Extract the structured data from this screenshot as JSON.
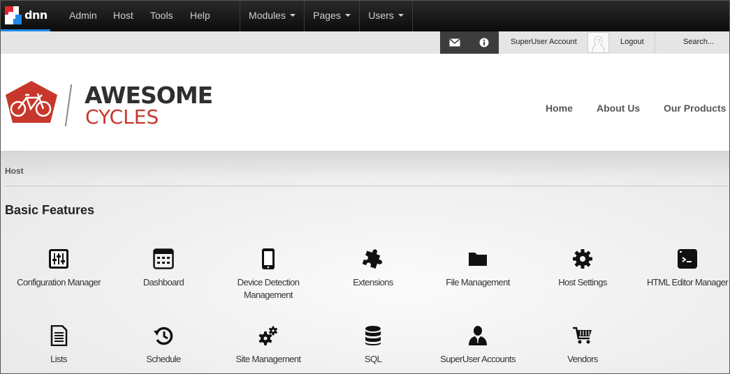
{
  "controlbar": {
    "logo_text": "dnn",
    "menu": [
      "Admin",
      "Host",
      "Tools",
      "Help"
    ],
    "dropdowns": [
      "Modules",
      "Pages",
      "Users"
    ]
  },
  "userbar": {
    "account": "SuperUser Account",
    "logout": "Logout",
    "search": "Search..."
  },
  "brand": {
    "line1": "AWESOME",
    "line2": "CYCLES"
  },
  "nav": [
    "Home",
    "About Us",
    "Our Products"
  ],
  "breadcrumb": "Host",
  "section_title": "Basic Features",
  "features": [
    {
      "label": "Configuration Manager",
      "icon": "sliders-icon"
    },
    {
      "label": "Dashboard",
      "icon": "dashboard-icon"
    },
    {
      "label": "Device Detection Management",
      "icon": "mobile-device-icon"
    },
    {
      "label": "Extensions",
      "icon": "puzzle-icon"
    },
    {
      "label": "File Management",
      "icon": "folder-icon"
    },
    {
      "label": "Host Settings",
      "icon": "gear-icon"
    },
    {
      "label": "HTML Editor Manager",
      "icon": "terminal-icon"
    },
    {
      "label": "Lists",
      "icon": "list-document-icon"
    },
    {
      "label": "Schedule",
      "icon": "history-clock-icon"
    },
    {
      "label": "Site Management",
      "icon": "gears-icon"
    },
    {
      "label": "SQL",
      "icon": "database-icon"
    },
    {
      "label": "SuperUser Accounts",
      "icon": "user-icon"
    },
    {
      "label": "Vendors",
      "icon": "cart-icon"
    }
  ],
  "colors": {
    "accent_blue": "#1e88e5",
    "brand_red": "#c8372b",
    "dark": "#111111"
  }
}
